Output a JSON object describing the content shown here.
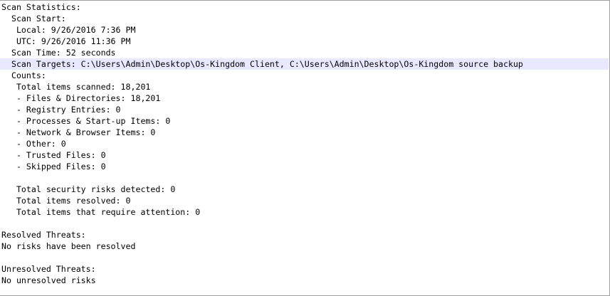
{
  "log": {
    "lines": [
      {
        "text": "Scan Statistics:",
        "highlighted": false
      },
      {
        "text": "  Scan Start:",
        "highlighted": false
      },
      {
        "text": "   Local: 9/26/2016 7:36 PM",
        "highlighted": false
      },
      {
        "text": "   UTC: 9/26/2016 11:36 PM",
        "highlighted": false
      },
      {
        "text": "  Scan Time: 52 seconds",
        "highlighted": false
      },
      {
        "text": "  Scan Targets: C:\\Users\\Admin\\Desktop\\Os-Kingdom Client, C:\\Users\\Admin\\Desktop\\Os-Kingdom source backup",
        "highlighted": true
      },
      {
        "text": "  Counts:",
        "highlighted": false
      },
      {
        "text": "   Total items scanned: 18,201",
        "highlighted": false
      },
      {
        "text": "   - Files & Directories: 18,201",
        "highlighted": false
      },
      {
        "text": "   - Registry Entries: 0",
        "highlighted": false
      },
      {
        "text": "   - Processes & Start-up Items: 0",
        "highlighted": false
      },
      {
        "text": "   - Network & Browser Items: 0",
        "highlighted": false
      },
      {
        "text": "   - Other: 0",
        "highlighted": false
      },
      {
        "text": "   - Trusted Files: 0",
        "highlighted": false
      },
      {
        "text": "   - Skipped Files: 0",
        "highlighted": false
      },
      {
        "text": "",
        "highlighted": false
      },
      {
        "text": "   Total security risks detected: 0",
        "highlighted": false
      },
      {
        "text": "   Total items resolved: 0",
        "highlighted": false
      },
      {
        "text": "   Total items that require attention: 0",
        "highlighted": false
      },
      {
        "text": "",
        "highlighted": false
      },
      {
        "text": "Resolved Threats:",
        "highlighted": false
      },
      {
        "text": "No risks have been resolved",
        "highlighted": false
      },
      {
        "text": "",
        "highlighted": false
      },
      {
        "text": "Unresolved Threats:",
        "highlighted": false
      },
      {
        "text": "No unresolved risks",
        "highlighted": false
      }
    ]
  }
}
